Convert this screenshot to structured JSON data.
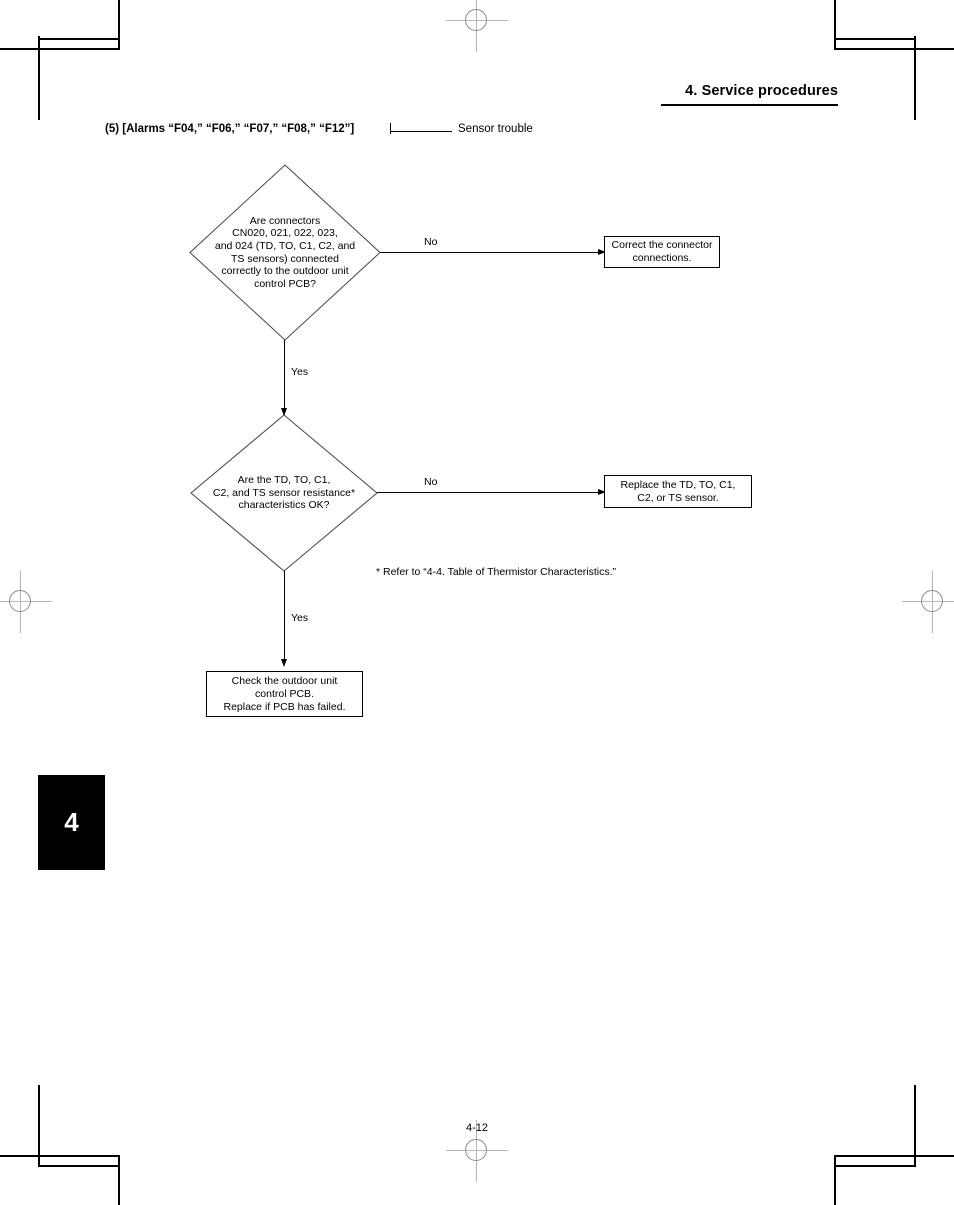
{
  "page": {
    "chapter_header": "4. Service procedures",
    "chapter_tab_number": "4",
    "page_number": "4-12",
    "ink_color": "#000000",
    "registration_mark_color": "#b5b5b5"
  },
  "section": {
    "alarm_title": "(5) [Alarms “F04,” “F06,” “F07,” “F08,” “F12”]",
    "trouble_label": "Sensor trouble"
  },
  "flowchart": {
    "decision1": {
      "lines": [
        "Are connectors",
        "CN020, 021, 022, 023,",
        "and 024 (TD, TO, C1, C2, and",
        "TS sensors) connected",
        "correctly to the outdoor unit",
        "control PCB?"
      ],
      "no_label": "No",
      "yes_label": "Yes"
    },
    "action1": {
      "lines": [
        "Correct the connector",
        "connections."
      ]
    },
    "decision2": {
      "lines": [
        "Are the TD, TO, C1,",
        "C2, and TS sensor resistance*",
        "characteristics OK?"
      ],
      "no_label": "No",
      "yes_label": "Yes"
    },
    "action2": {
      "lines": [
        "Replace the TD, TO, C1,",
        "C2, or TS sensor."
      ]
    },
    "terminal": {
      "lines": [
        "Check the outdoor unit",
        "control PCB.",
        "Replace if PCB has failed."
      ]
    },
    "footnote": "* Refer to “4-4. Table of Thermistor Characteristics.”"
  }
}
